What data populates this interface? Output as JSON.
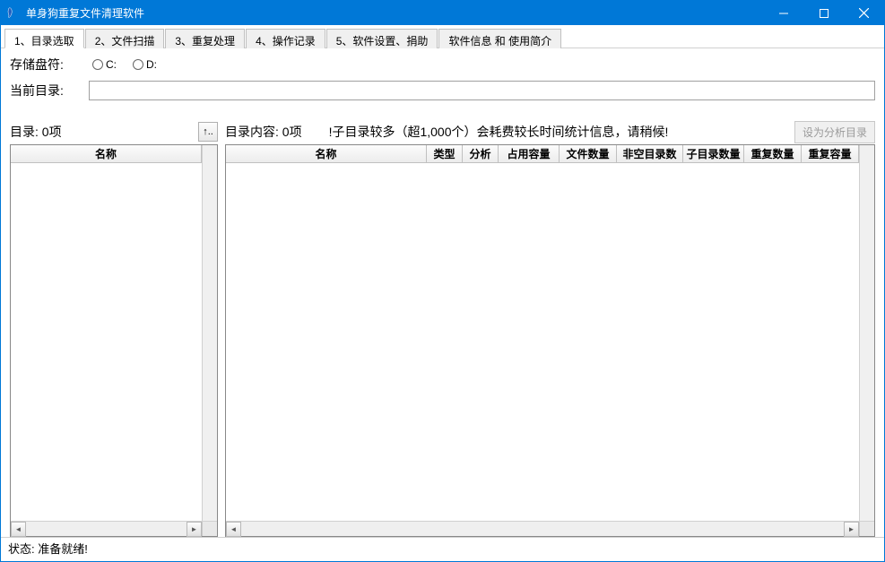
{
  "window": {
    "title": "单身狗重复文件清理软件"
  },
  "tabs": [
    {
      "label": "1、目录选取",
      "active": true
    },
    {
      "label": "2、文件扫描",
      "active": false
    },
    {
      "label": "3、重复处理",
      "active": false
    },
    {
      "label": "4、操作记录",
      "active": false
    },
    {
      "label": "5、软件设置、捐助",
      "active": false
    },
    {
      "label": "软件信息 和 使用简介",
      "active": false
    }
  ],
  "drive": {
    "label": "存储盘符:",
    "options": [
      "C:",
      "D:"
    ]
  },
  "currentDir": {
    "label": "当前目录:",
    "value": ""
  },
  "leftPane": {
    "header": "目录: 0项",
    "upBtn": "↑..",
    "columns": [
      "名称"
    ]
  },
  "rightPane": {
    "header": "目录内容: 0项",
    "info": "!子目录较多（超1,000个）会耗费较长时间统计信息，请稍候!",
    "analyzeBtn": "设为分析目录",
    "columns": [
      "名称",
      "类型",
      "分析",
      "占用容量",
      "文件数量",
      "非空目录数",
      "子目录数量",
      "重复数量",
      "重复容量"
    ]
  },
  "statusbar": {
    "text": "状态: 准备就绪!"
  }
}
